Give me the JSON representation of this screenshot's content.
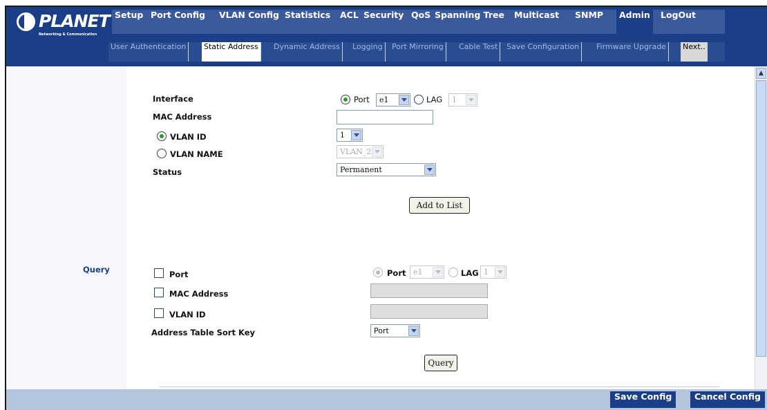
{
  "logo": {
    "brand": "PLANET",
    "tagline": "Networking & Communication"
  },
  "main_nav": [
    {
      "label": "Setup"
    },
    {
      "label": "Port Config"
    },
    {
      "label": "VLAN Config"
    },
    {
      "label": "Statistics"
    },
    {
      "label": "ACL"
    },
    {
      "label": "Security"
    },
    {
      "label": "QoS"
    },
    {
      "label": "Spanning Tree"
    },
    {
      "label": "Multicast"
    },
    {
      "label": "SNMP"
    },
    {
      "label": "Admin"
    },
    {
      "label": "LogOut"
    }
  ],
  "main_nav_active": "Admin",
  "sub_nav": [
    {
      "label": "User Authentication"
    },
    {
      "label": "Static Address"
    },
    {
      "label": "Dynamic Address"
    },
    {
      "label": "Logging"
    },
    {
      "label": "Port Mirroring"
    },
    {
      "label": "Cable Test"
    },
    {
      "label": "Save Configuration"
    },
    {
      "label": "Firmware Upgrade"
    },
    {
      "label": "Next.."
    }
  ],
  "sub_nav_active": "Static Address",
  "form": {
    "interface_label": "Interface",
    "port_option": "Port",
    "port_value": "e1",
    "lag_option": "LAG",
    "lag_value": "1",
    "mac_label": "MAC Address",
    "mac_value": "",
    "vlan_id_label": "VLAN ID",
    "vlan_id_value": "1",
    "vlan_name_label": "VLAN NAME",
    "vlan_name_value": "VLAN_2",
    "status_label": "Status",
    "status_value": "Permanent",
    "add_button": "Add to List"
  },
  "query": {
    "section_label": "Query",
    "port_label": "Port",
    "port_option": "Port",
    "port_value": "e1",
    "lag_option": "LAG",
    "lag_value": "1",
    "mac_label": "MAC Address",
    "vlan_label": "VLAN ID",
    "sort_label": "Address Table Sort Key",
    "sort_value": "Port",
    "query_button": "Query"
  },
  "footer": {
    "save_label": "Save Config",
    "cancel_label": "Cancel Config"
  },
  "colors": {
    "header_bg": "#1b3f86",
    "nav_bg": "#3a5a9c",
    "footer_bg": "#b5c5dd",
    "query_label": "#1b3f86"
  }
}
